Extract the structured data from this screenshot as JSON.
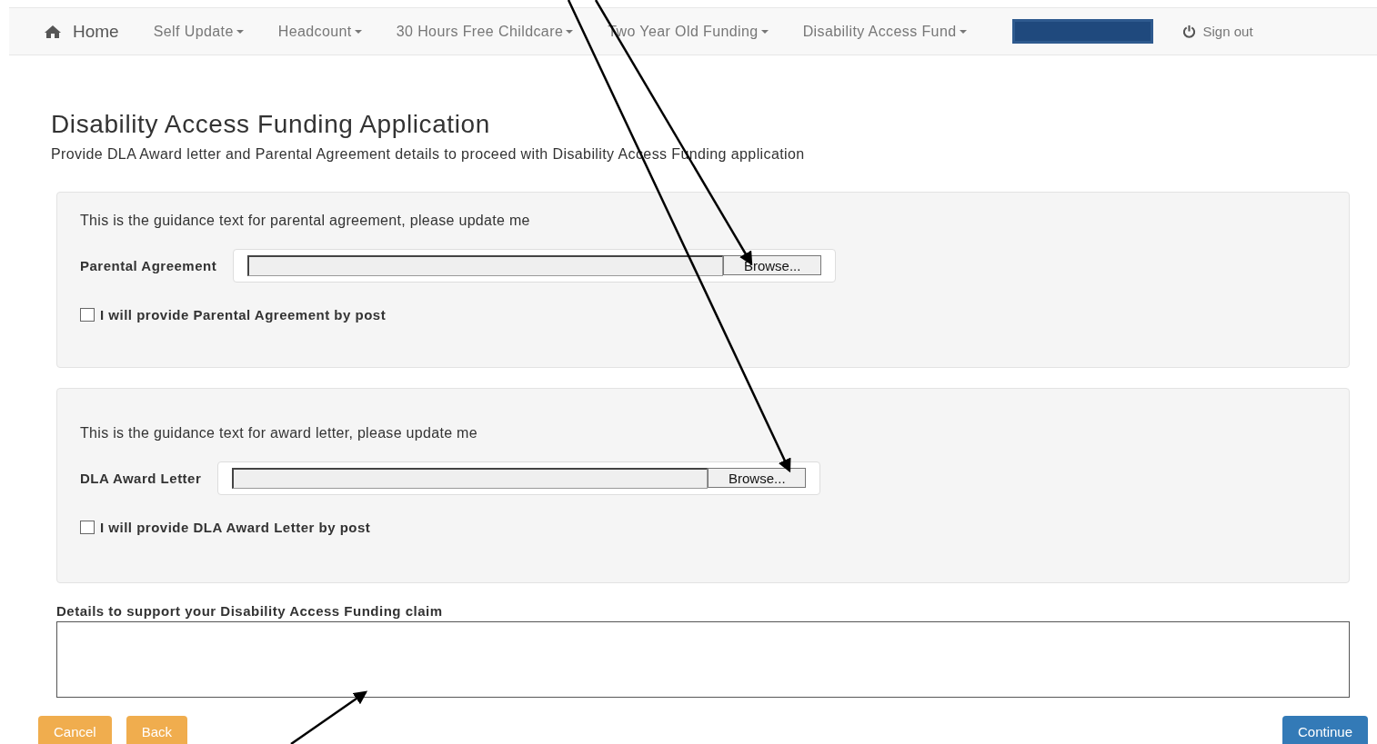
{
  "navbar": {
    "home": "Home",
    "items": [
      {
        "label": "Self Update"
      },
      {
        "label": "Headcount"
      },
      {
        "label": "30 Hours Free Childcare"
      },
      {
        "label": "Two Year Old Funding"
      },
      {
        "label": "Disability Access Fund"
      }
    ],
    "sign_out": "Sign out"
  },
  "heading": "Disability Access Funding Application",
  "intro": "Provide DLA Award letter and Parental Agreement details to proceed with Disability Access Funding application",
  "sections": [
    {
      "guidance": "This is the guidance text for parental agreement, please update me",
      "label": "Parental Agreement",
      "browse": "Browse...",
      "checkbox_label": "I will provide Parental Agreement by post",
      "checked": false
    },
    {
      "guidance": "This is the guidance text for award letter, please update me",
      "label": "DLA Award Letter",
      "browse": "Browse...",
      "checkbox_label": "I will provide DLA Award Letter by post",
      "checked": false
    }
  ],
  "details_label": "Details to support your Disability Access Funding claim",
  "buttons": {
    "cancel": "Cancel",
    "back": "Back",
    "continue": "Continue"
  }
}
